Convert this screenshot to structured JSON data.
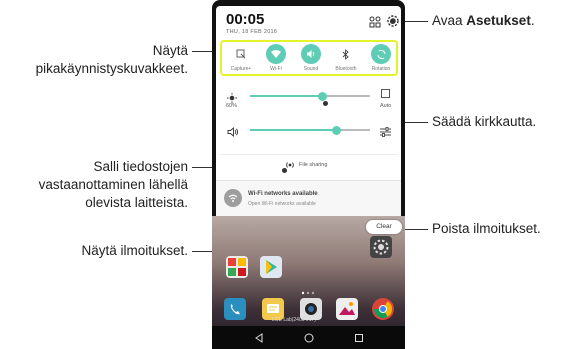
{
  "callouts": {
    "settings": {
      "prefix": "Avaa ",
      "bold": "Asetukset",
      "suffix": "."
    },
    "quick_settings": [
      "Näytä",
      "pikakäynnistyskuvakkeet."
    ],
    "brightness": "Säädä kirkkautta.",
    "file_sharing": [
      "Salli tiedostojen",
      "vastaanottaminen lähellä",
      "olevista laitteista."
    ],
    "notifications": "Näytä ilmoitukset.",
    "clear": "Poista ilmoitukset."
  },
  "phone": {
    "time": "00:05",
    "date": "THU, 18 FEB 2016",
    "quick_settings": [
      {
        "label": "Capture+",
        "icon": "capture-plus-icon",
        "active": false
      },
      {
        "label": "Wi-Fi",
        "icon": "wifi-icon",
        "active": true
      },
      {
        "label": "Sound",
        "icon": "sound-icon",
        "active": true
      },
      {
        "label": "Bluetooth",
        "icon": "bluetooth-icon",
        "active": false
      },
      {
        "label": "Rotation",
        "icon": "rotation-icon",
        "active": true
      }
    ],
    "brightness": {
      "percent_label": "60%",
      "auto_label": "Auto",
      "level": 0.6
    },
    "volume": {
      "level": 0.72
    },
    "file_sharing_label": "File sharing",
    "notification": {
      "title": "Wi-Fi networks available",
      "subtitle": "Open Wi-Fi networks available"
    },
    "clear_label": "Clear",
    "carrier_text": "LGE Lab(2400 e17)",
    "accent_color": "#5fcdb5",
    "highlight_color": "#e5f32b"
  }
}
